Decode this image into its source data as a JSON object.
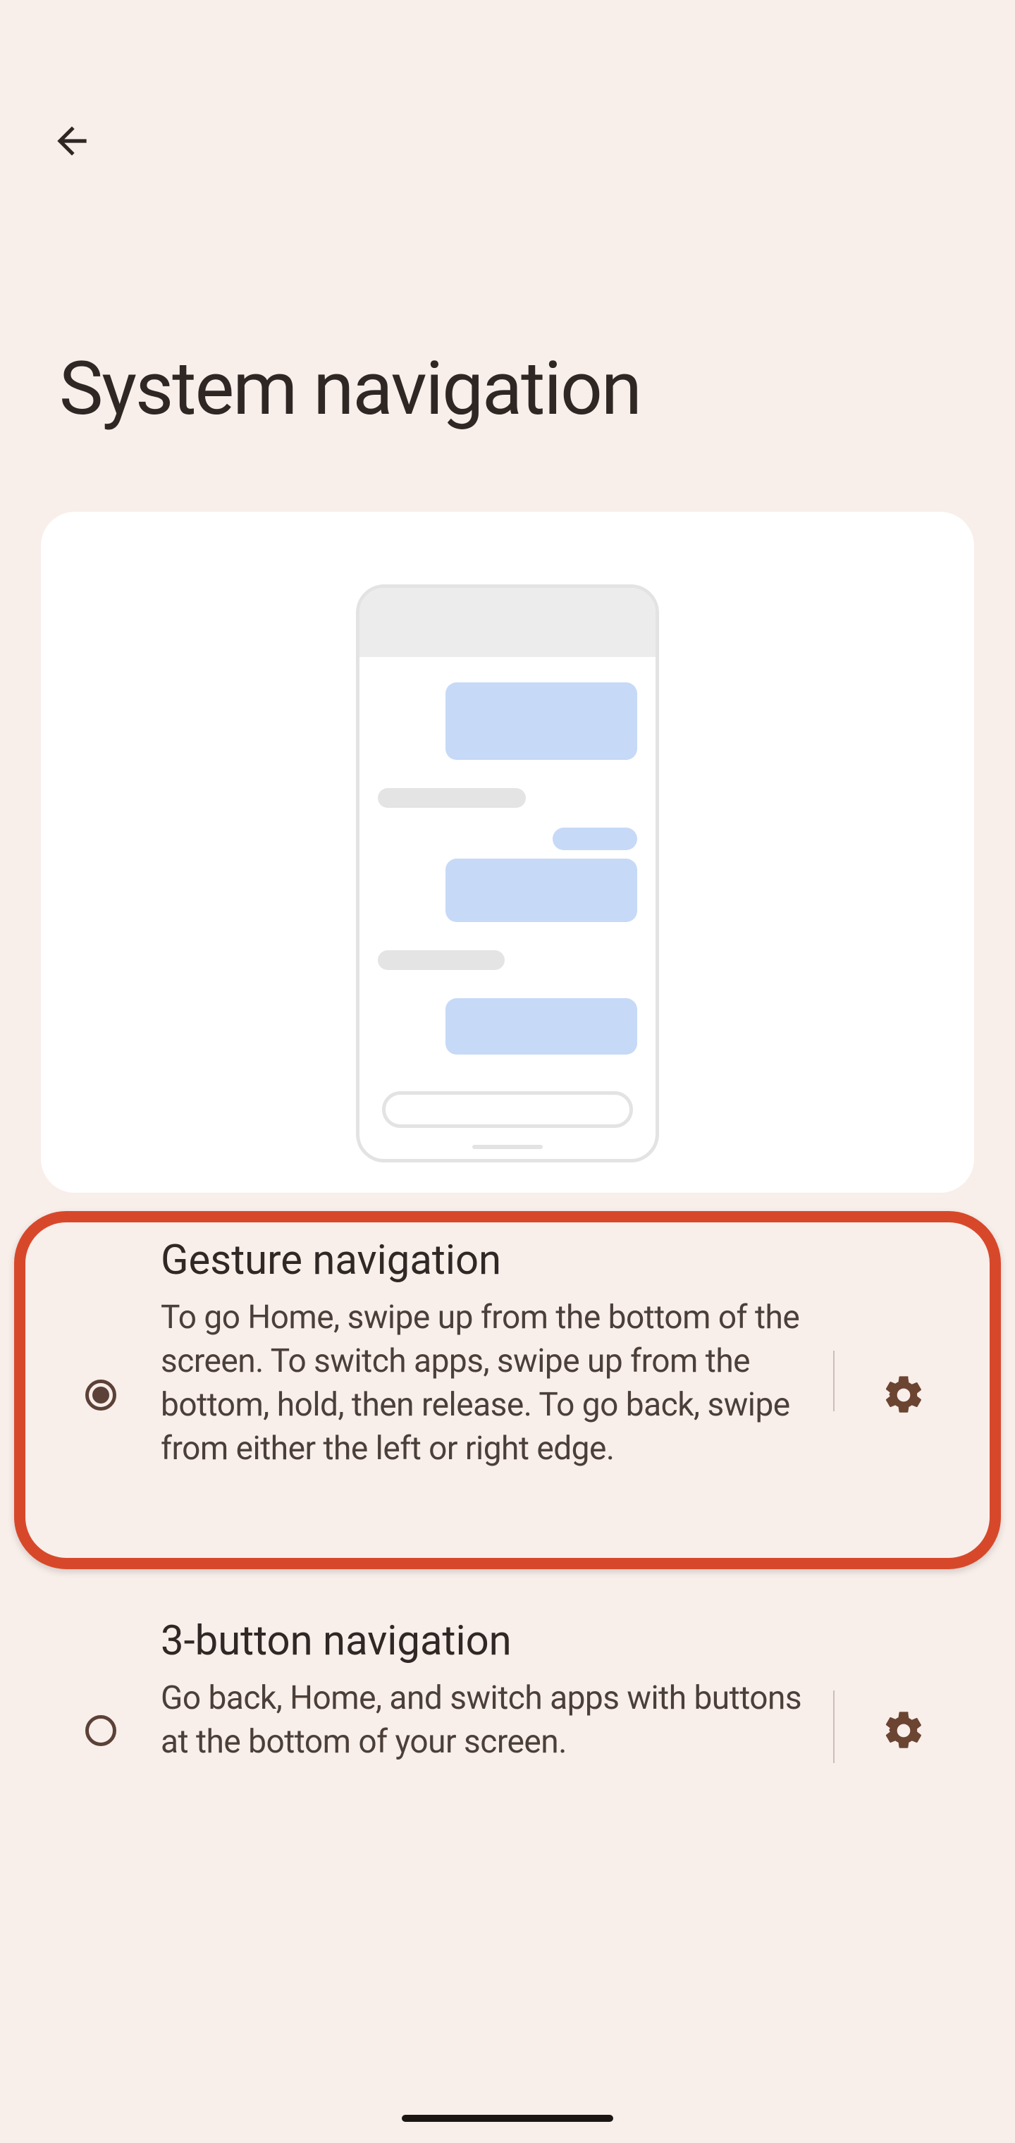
{
  "header": {
    "title": "System navigation"
  },
  "options": {
    "gesture": {
      "title": "Gesture navigation",
      "description": "To go Home, swipe up from the bot­tom of the screen. To switch apps, swipe up from the bottom, hold, then release. To go back, swipe from either the left or right edge.",
      "selected": true
    },
    "three_button": {
      "title": "3-button navigation",
      "description": "Go back, Home, and switch apps with buttons at the bottom of your screen.",
      "selected": false
    }
  },
  "icons": {
    "back": "arrow-left",
    "gear": "settings-gear"
  },
  "colors": {
    "background": "#f8eeea",
    "accent": "#5b4137",
    "highlight": "#d7482b"
  }
}
